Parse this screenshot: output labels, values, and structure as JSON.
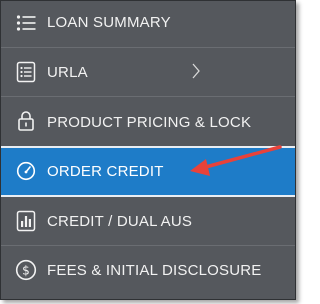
{
  "nav": {
    "items": [
      {
        "label": "LOAN SUMMARY",
        "icon": "list-icon"
      },
      {
        "label": "URLA",
        "icon": "document-list-icon",
        "has_submenu": true
      },
      {
        "label": "PRODUCT PRICING & LOCK",
        "icon": "lock-icon"
      },
      {
        "label": "ORDER CREDIT",
        "icon": "gauge-icon",
        "active": true
      },
      {
        "label": "CREDIT / DUAL AUS",
        "icon": "bar-chart-icon"
      },
      {
        "label": "FEES & INITIAL DISCLOSURE",
        "icon": "dollar-circle-icon"
      }
    ]
  },
  "colors": {
    "sidebar_background": "#55585d",
    "active_background": "#1e7cc8",
    "text": "#f2f2f2",
    "annotation_arrow": "#e8423a"
  }
}
